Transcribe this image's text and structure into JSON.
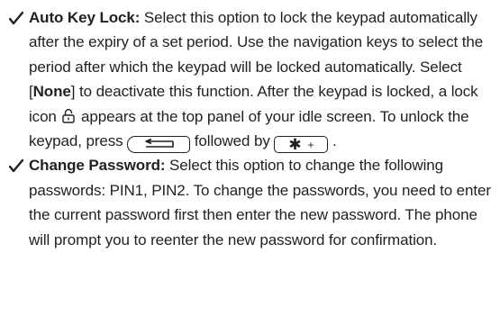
{
  "items": [
    {
      "term": "Auto Key Lock:",
      "text_1": " Select this option to lock the keypad automatically after the expiry of a set period. Use the navigation keys to select the period after which the keypad will be locked automatically. Select [",
      "bold_option": "None",
      "text_2": "] to deactivate this function. After the keypad is locked, a lock icon ",
      "text_3": " appears at the top panel of your idle screen. To unlock the keypad, press ",
      "text_4": " followed by ",
      "text_5": " .",
      "icons": {
        "bullet": "checkmark-icon",
        "lock": "lock-icon",
        "back_key": "back-key-icon",
        "star_key": "star-key-icon"
      },
      "star_key_symbols": {
        "star": "✱",
        "plus": "+"
      }
    },
    {
      "term": "Change Password:",
      "text_1": " Select this option to change the following passwords: PIN1, PIN2. To change the passwords, you need to enter the current password first then enter the new password. The phone will prompt you to reenter the new password for confirmation.",
      "icons": {
        "bullet": "checkmark-icon"
      }
    }
  ]
}
